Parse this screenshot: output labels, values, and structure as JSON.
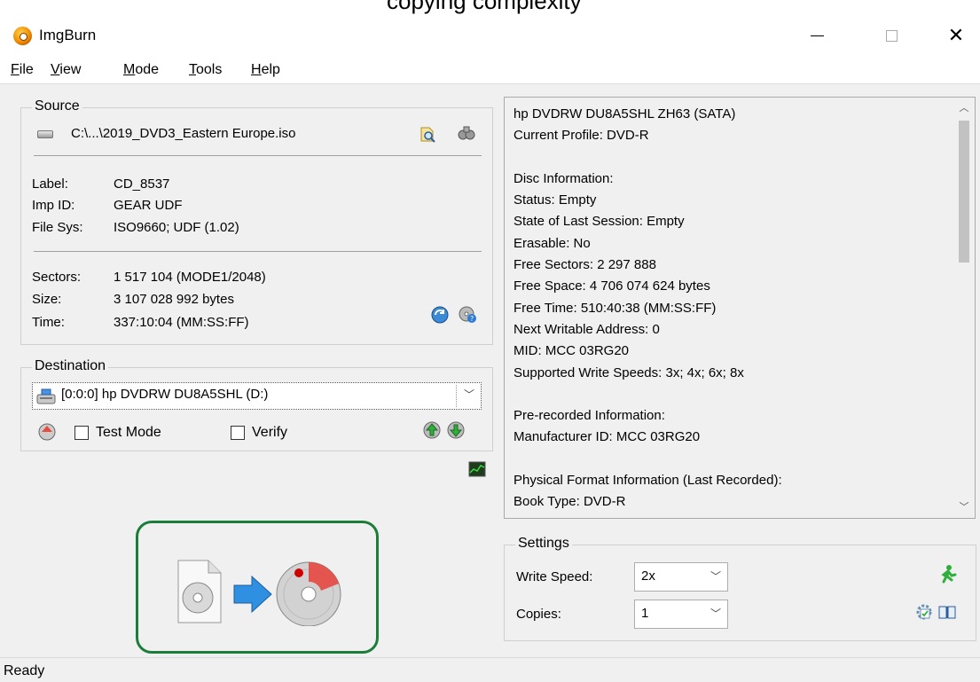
{
  "window": {
    "title": "ImgBurn",
    "top_fragment": "copying complexity"
  },
  "menu": [
    {
      "label": "File",
      "key": "F",
      "rest": "ile"
    },
    {
      "label": "View",
      "key": "V",
      "rest": "iew"
    },
    {
      "label": "Mode",
      "key": "M",
      "rest": "ode"
    },
    {
      "label": "Tools",
      "key": "T",
      "rest": "ools"
    },
    {
      "label": "Help",
      "key": "H",
      "rest": "elp"
    }
  ],
  "source": {
    "title": "Source",
    "path": "C:\\...\\2019_DVD3_Eastern Europe.iso",
    "label_key": "Label:",
    "label_val": "CD_8537",
    "impid_key": "Imp ID:",
    "impid_val": "GEAR UDF",
    "filesys_key": "File Sys:",
    "filesys_val": "ISO9660; UDF (1.02)",
    "sectors_key": "Sectors:",
    "sectors_val": "1 517 104 (MODE1/2048)",
    "size_key": "Size:",
    "size_val": "3 107 028 992 bytes",
    "time_key": "Time:",
    "time_val": "337:10:04 (MM:SS:FF)"
  },
  "destination": {
    "title": "Destination",
    "drive": "[0:0:0] hp DVDRW  DU8A5SHL (D:)",
    "test_mode": "Test Mode",
    "verify": "Verify"
  },
  "info": {
    "lines": [
      "hp DVDRW  DU8A5SHL ZH63 (SATA)",
      "Current Profile: DVD-R",
      "",
      "Disc Information:",
      "Status: Empty",
      "State of Last Session: Empty",
      "Erasable: No",
      "Free Sectors: 2 297 888",
      "Free Space: 4 706 074 624 bytes",
      "Free Time: 510:40:38 (MM:SS:FF)",
      "Next Writable Address: 0",
      "MID: MCC 03RG20",
      "Supported Write Speeds: 3x; 4x; 6x; 8x",
      "",
      "Pre-recorded Information:",
      "Manufacturer ID: MCC 03RG20",
      "",
      "Physical Format Information (Last Recorded):",
      "Book Type: DVD-R"
    ]
  },
  "settings": {
    "title": "Settings",
    "write_speed_label": "Write Speed:",
    "write_speed": "2x",
    "copies_label": "Copies:",
    "copies": "1"
  },
  "status": {
    "text": "Ready"
  },
  "colors": {
    "accent_border": "#1a7d3a",
    "panel_bg": "#f0f0f0"
  }
}
